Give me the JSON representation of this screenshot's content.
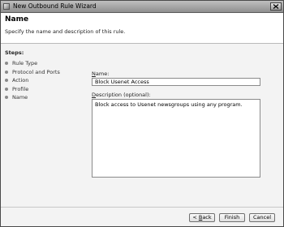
{
  "window": {
    "title": "New Outbound Rule Wizard",
    "close_label": "×"
  },
  "header": {
    "title": "Name",
    "subtitle": "Specify the name and description of this rule."
  },
  "steps": {
    "heading": "Steps:",
    "items": [
      {
        "label": "Rule Type"
      },
      {
        "label": "Protocol and Ports"
      },
      {
        "label": "Action"
      },
      {
        "label": "Profile"
      },
      {
        "label": "Name"
      }
    ]
  },
  "form": {
    "name_label_accel": "N",
    "name_label_rest": "ame:",
    "name_value": "Block Usenet Access",
    "description_label_accel": "D",
    "description_label_rest": "escription (optional):",
    "description_value": "Block access to Usenet newsgroups using any program."
  },
  "buttons": {
    "back_prefix": "< ",
    "back_accel": "B",
    "back_rest": "ack",
    "finish_label": "Finish",
    "cancel_label": "Cancel"
  },
  "colors": {
    "titlebar": "#9f9f9f",
    "header_background": "#ffffff",
    "body_background": "#f3f3f3"
  }
}
